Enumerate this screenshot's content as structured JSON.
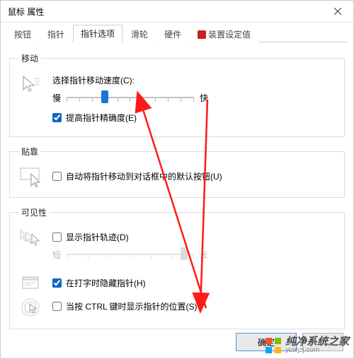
{
  "window": {
    "title": "鼠标 属性"
  },
  "tabs": {
    "items": [
      {
        "label": "按钮"
      },
      {
        "label": "指针"
      },
      {
        "label": "指针选项"
      },
      {
        "label": "滑轮"
      },
      {
        "label": "硬件"
      },
      {
        "label": "装置设定值"
      }
    ],
    "active_index": 2
  },
  "groups": {
    "motion": {
      "legend": "移动",
      "speed_label": "选择指针移动速度(C):",
      "slow": "慢",
      "fast": "快",
      "speed_value_percent": 30,
      "enhance_label": "提高指针精确度(E)",
      "enhance_checked": true
    },
    "snap": {
      "legend": "贴靠",
      "snap_label": "自动将指针移动到对话框中的默认按钮(U)",
      "snap_checked": false
    },
    "visibility": {
      "legend": "可见性",
      "trail_label": "显示指针轨迹(D)",
      "trail_checked": false,
      "trail_short": "短",
      "trail_long": "长",
      "trail_value_percent": 92,
      "hide_label": "在打字时隐藏指针(H)",
      "hide_checked": true,
      "locate_label": "当按 CTRL 键时显示指针的位置(S)",
      "locate_checked": false
    }
  },
  "buttons": {
    "ok": "确定"
  },
  "watermark": {
    "text": "纯净系统之家",
    "url": "ycwjzj.com"
  }
}
